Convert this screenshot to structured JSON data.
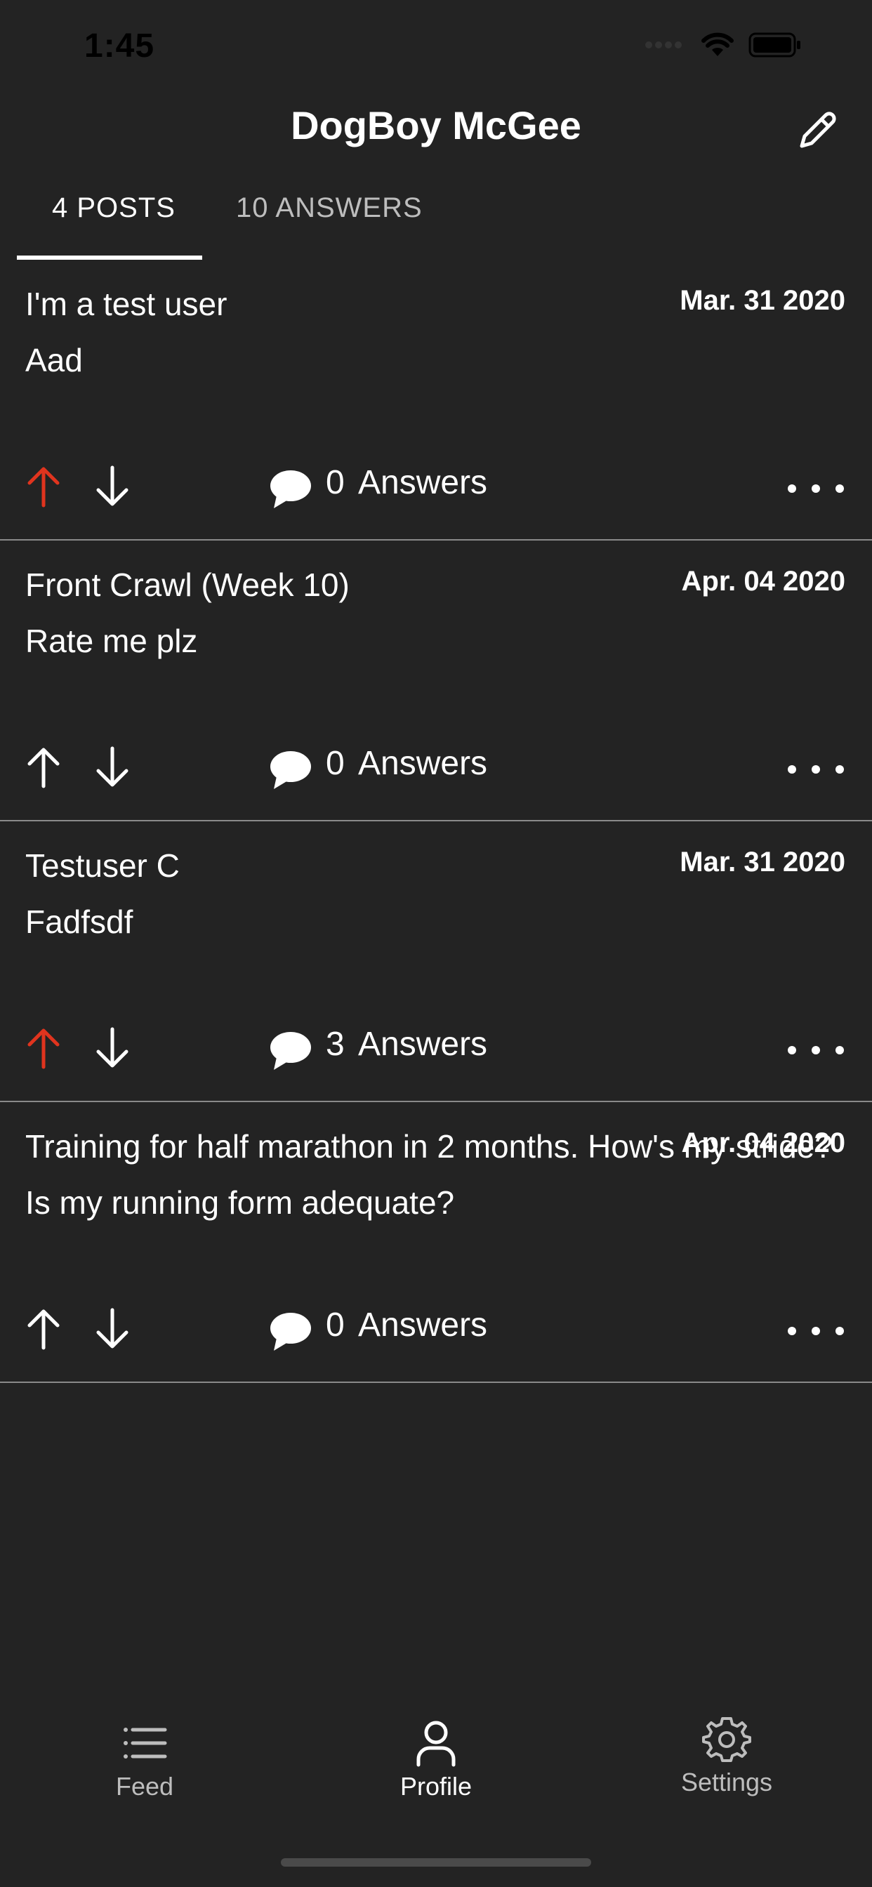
{
  "status_bar": {
    "time": "1:45"
  },
  "header": {
    "title": "DogBoy McGee"
  },
  "tabs": {
    "posts_label": "4 POSTS",
    "answers_label": "10 ANSWERS"
  },
  "posts": [
    {
      "title": "I'm a test user",
      "body": "Aad",
      "date": "Mar. 31 2020",
      "answers_count": "0",
      "answers_label": "Answers",
      "upvoted": true
    },
    {
      "title": "Front Crawl (Week 10)",
      "body": "Rate me plz",
      "date": "Apr. 04 2020",
      "answers_count": "0",
      "answers_label": "Answers",
      "upvoted": false
    },
    {
      "title": "Testuser C",
      "body": "Fadfsdf",
      "date": "Mar. 31 2020",
      "answers_count": "3",
      "answers_label": "Answers",
      "upvoted": true
    },
    {
      "title": "Training for half marathon in 2 months. How's my stride?",
      "body": "Is my running form adequate?",
      "date": "Apr. 04 2020",
      "answers_count": "0",
      "answers_label": "Answers",
      "upvoted": false
    }
  ],
  "bottom_nav": {
    "feed": "Feed",
    "profile": "Profile",
    "settings": "Settings"
  },
  "colors": {
    "background": "#232323",
    "upvote_active": "#e0341e",
    "text": "#ffffff",
    "muted": "#bdbdbd",
    "divider": "#8a8a8a"
  }
}
